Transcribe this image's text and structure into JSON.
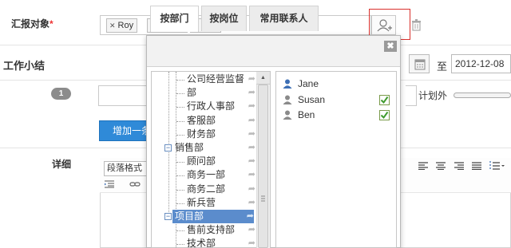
{
  "form": {
    "recipients_label": "汇报对象",
    "required_mark": "*",
    "recipients": [
      "Roy",
      "Susan",
      "Ben"
    ],
    "remove_glyph": "✕",
    "work_summary_label": "工作小结",
    "date_separator": "至",
    "end_date": "2012-12-08",
    "item_number": "1",
    "plan_label": "计划外",
    "add_item_button": "增加一条",
    "detail_label": "详细",
    "paragraph_format": "段落格式"
  },
  "popup": {
    "tabs": [
      "按部门",
      "按岗位",
      "常用联系人"
    ],
    "active_tab": 0,
    "close_glyph": "✖",
    "tree": [
      {
        "label": "公司经营监督",
        "depth": 1
      },
      {
        "label": "部",
        "depth": 1
      },
      {
        "label": "行政人事部",
        "depth": 1
      },
      {
        "label": "客服部",
        "depth": 1
      },
      {
        "label": "财务部",
        "depth": 1
      },
      {
        "label": "销售部",
        "depth": 0,
        "expander": "−"
      },
      {
        "label": "顾问部",
        "depth": 1
      },
      {
        "label": "商务一部",
        "depth": 1
      },
      {
        "label": "商务二部",
        "depth": 1
      },
      {
        "label": "新兵营",
        "depth": 1
      },
      {
        "label": "项目部",
        "depth": 0,
        "expander": "−",
        "selected": true
      },
      {
        "label": "售前支持部",
        "depth": 1
      },
      {
        "label": "技术部",
        "depth": 1
      }
    ],
    "members": [
      {
        "name": "Jane",
        "checked": false,
        "icon_color": "#3d6fb5"
      },
      {
        "name": "Susan",
        "checked": true,
        "icon_color": "#8a8a8a"
      },
      {
        "name": "Ben",
        "checked": true,
        "icon_color": "#8a8a8a"
      }
    ]
  },
  "colors": {
    "accent": "#2f8ad8",
    "highlight": "#d9302c",
    "tree_selected": "#5b8ccc",
    "check_green": "#3f9b2e"
  }
}
